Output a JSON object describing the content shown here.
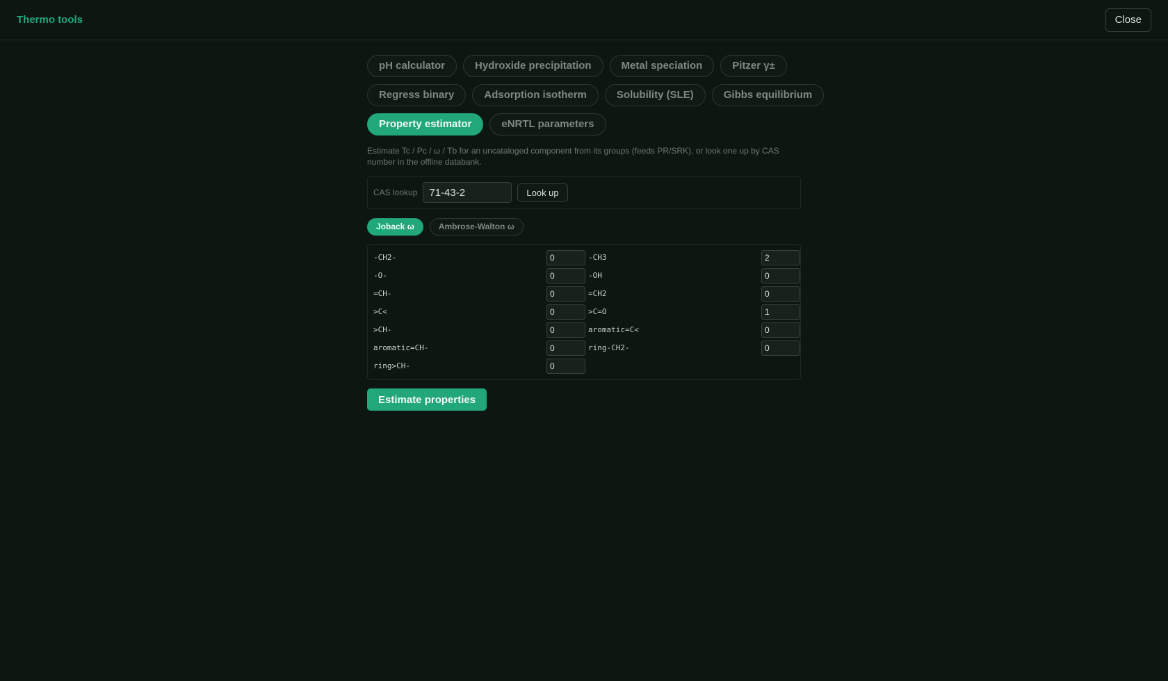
{
  "app": {
    "title": "Thermo tools",
    "close_label": "Close"
  },
  "tabs": [
    [
      "pH calculator",
      "Hydroxide precipitation",
      "Metal speciation",
      "Pitzer γ±"
    ],
    [
      "Regress binary",
      "Adsorption isotherm",
      "Solubility (SLE)",
      "Gibbs equilibrium"
    ],
    [
      "Property estimator",
      "eNRTL parameters"
    ]
  ],
  "active_tab": "Property estimator",
  "description": "Estimate Tc / Pc / ω / Tb for an uncataloged component from its groups (feeds PR/SRK), or look one up by CAS number in the offline databank.",
  "cas": {
    "label": "CAS lookup",
    "value": "71-43-2",
    "button_label": "Look up"
  },
  "methods": {
    "joback": "Joback ω",
    "ambrose": "Ambrose-Walton ω",
    "active": "joback"
  },
  "groups": [
    {
      "name": "-CH2-",
      "value": "0"
    },
    {
      "name": "-CH3",
      "value": "2"
    },
    {
      "name": "-O-",
      "value": "0"
    },
    {
      "name": "-OH",
      "value": "0"
    },
    {
      "name": "=CH-",
      "value": "0"
    },
    {
      "name": "=CH2",
      "value": "0"
    },
    {
      "name": ">C<",
      "value": "0"
    },
    {
      "name": ">C=O",
      "value": "1"
    },
    {
      "name": ">CH-",
      "value": "0"
    },
    {
      "name": "aromatic=C<",
      "value": "0"
    },
    {
      "name": "aromatic=CH-",
      "value": "0"
    },
    {
      "name": "ring-CH2-",
      "value": "0"
    },
    {
      "name": "ring>CH-",
      "value": "0"
    }
  ],
  "estimate_label": "Estimate properties",
  "colors": {
    "accent": "#21a77a",
    "background": "#0e1612"
  }
}
